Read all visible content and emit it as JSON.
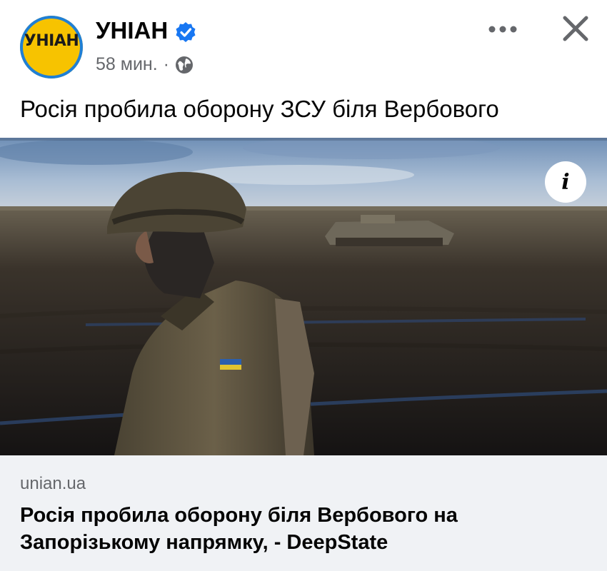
{
  "post": {
    "page_name": "УНІАН",
    "avatar_text": "УНІАН",
    "time": "58 мин.",
    "separator": "·",
    "text": "Росія пробила оборону ЗСУ біля Вербового"
  },
  "link_preview": {
    "domain": "unian.ua",
    "title": "Росія пробила оборону біля Вербового на Запорізькому напрямку, - DeepState",
    "info_label": "i"
  },
  "icons": {
    "verified": "verified-badge-icon",
    "audience": "globe-icon",
    "more": "more-options-icon",
    "close": "close-icon"
  },
  "colors": {
    "brand_yellow": "#f7c300",
    "verified_blue": "#1877f2",
    "secondary_text": "#65676b",
    "link_bg": "#f0f2f5"
  }
}
